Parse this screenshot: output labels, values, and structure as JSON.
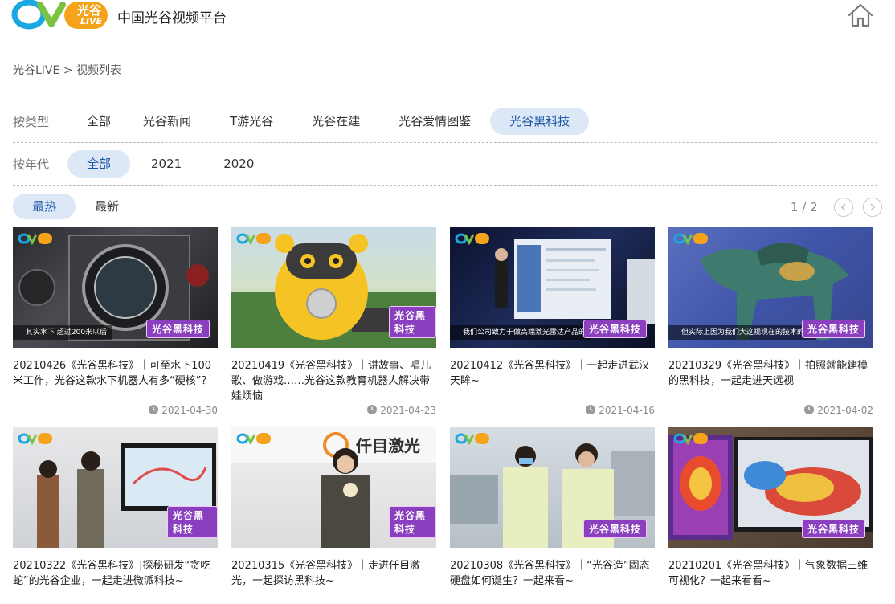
{
  "header": {
    "logo_text": "光谷",
    "logo_sub": "LIVE",
    "site_title": "中国光谷视频平台"
  },
  "breadcrumb": {
    "root": "光谷LIVE",
    "separator": ">",
    "current": "视频列表"
  },
  "filters": {
    "type_label": "按类型",
    "types": [
      "全部",
      "光谷新闻",
      "T游光谷",
      "光谷在建",
      "光谷爱情图鉴",
      "光谷黑科技"
    ],
    "type_active": "光谷黑科技",
    "year_label": "按年代",
    "years": [
      "全部",
      "2021",
      "2020"
    ],
    "year_active": "全部"
  },
  "sort": {
    "options": [
      "最热",
      "最新"
    ],
    "active": "最热"
  },
  "pager": {
    "text": "1 / 2"
  },
  "badge_text": "光谷黑科技",
  "videos": [
    {
      "title": "20210426《光谷黑科技》｜可至水下100米工作，光谷这款水下机器人有多“硬核”？",
      "date": "2021-04-30",
      "subtitle": "其实水下 超过200米以后"
    },
    {
      "title": "20210419《光谷黑科技》｜讲故事、唱儿歌、做游戏……光谷这款教育机器人解决带娃烦恼",
      "date": "2021-04-23",
      "subtitle": ""
    },
    {
      "title": "20210412《光谷黑科技》｜一起走进武汉天眸~",
      "date": "2021-04-16",
      "subtitle": "我们公司致力于做高端激光雷达产品的"
    },
    {
      "title": "20210329《光谷黑科技》｜拍照就能建模的黑科技，一起走进天远视",
      "date": "2021-04-02",
      "subtitle": "但实际上因为我们大这视现在的技术的话"
    },
    {
      "title": "20210322《光谷黑科技》|探秘研发“贪吃蛇”的光谷企业，一起走进微派科技~",
      "date": "",
      "subtitle": ""
    },
    {
      "title": "20210315《光谷黑科技》｜走进仟目激光，一起探访黑科技~",
      "date": "",
      "subtitle": ""
    },
    {
      "title": "20210308《光谷黑科技》｜“光谷造”固态硬盘如何诞生？一起来看~",
      "date": "",
      "subtitle": ""
    },
    {
      "title": "20210201《光谷黑科技》｜气象数据三维可视化？一起来看看~",
      "date": "",
      "subtitle": ""
    }
  ],
  "colors": {
    "active_pill_bg": "#dde8f6",
    "active_pill_text": "#1b56a8",
    "badge": "#8a3fbf"
  }
}
